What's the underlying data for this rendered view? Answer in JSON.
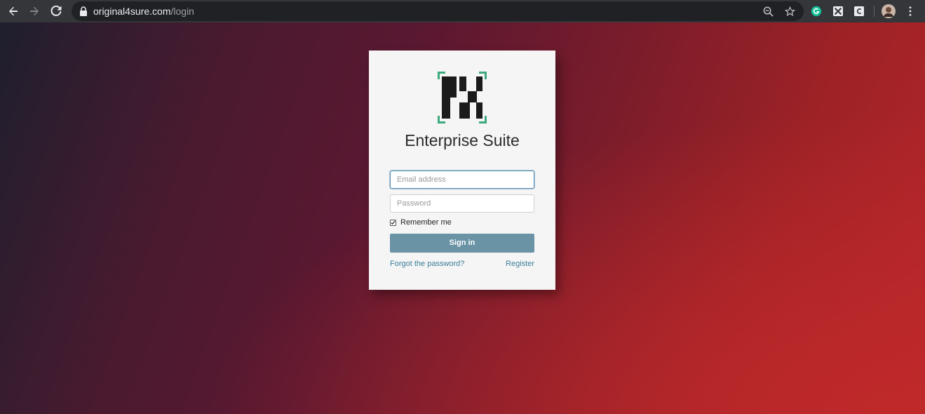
{
  "browser": {
    "url_domain": "original4sure.com",
    "url_path": "/login",
    "icons": [
      "back-icon",
      "forward-icon",
      "reload-icon",
      "lock-icon",
      "zoom-icon",
      "star-icon",
      "grammarly-icon",
      "extension-x-icon",
      "extension-c-icon",
      "profile-avatar",
      "menu-dots-icon"
    ]
  },
  "login": {
    "app_title": "Enterprise Suite",
    "email_placeholder": "Email address",
    "email_value": "",
    "password_placeholder": "Password",
    "password_value": "",
    "remember_label": "Remember me",
    "remember_checked": true,
    "signin_label": "Sign in",
    "forgot_label": "Forgot the password?",
    "register_label": "Register"
  },
  "colors": {
    "button": "#6a93a6",
    "link": "#3a7d99",
    "logo_bracket": "#3dab7e",
    "logo_block": "#1b1b1b",
    "card": "#f5f5f5"
  }
}
